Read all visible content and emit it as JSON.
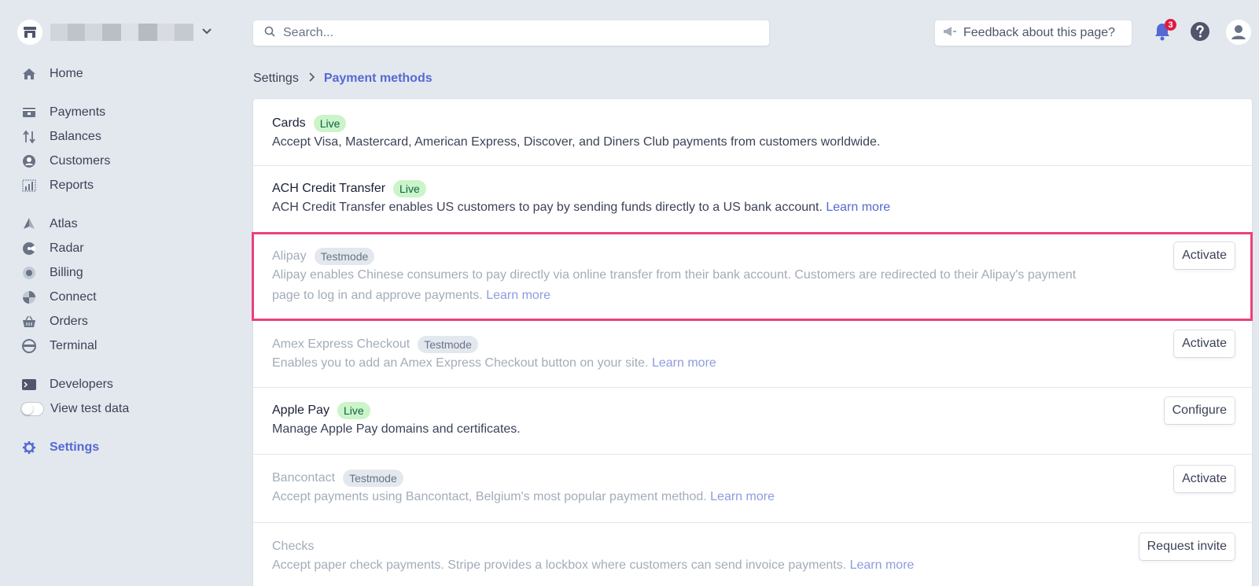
{
  "topbar": {
    "search_placeholder": "Search...",
    "feedback_label": "Feedback about this page?",
    "notification_count": "3"
  },
  "sidebar": {
    "items": [
      {
        "label": "Home",
        "icon": "home-icon"
      },
      {
        "label": "Payments",
        "icon": "payments-icon"
      },
      {
        "label": "Balances",
        "icon": "balances-icon"
      },
      {
        "label": "Customers",
        "icon": "customers-icon"
      },
      {
        "label": "Reports",
        "icon": "reports-icon"
      },
      {
        "label": "Atlas",
        "icon": "atlas-icon"
      },
      {
        "label": "Radar",
        "icon": "radar-icon"
      },
      {
        "label": "Billing",
        "icon": "billing-icon"
      },
      {
        "label": "Connect",
        "icon": "connect-icon"
      },
      {
        "label": "Orders",
        "icon": "orders-icon"
      },
      {
        "label": "Terminal",
        "icon": "terminal-icon"
      },
      {
        "label": "Developers",
        "icon": "developers-icon"
      },
      {
        "label": "View test data",
        "icon": "toggle"
      },
      {
        "label": "Settings",
        "icon": "gear-icon"
      }
    ]
  },
  "breadcrumb": {
    "root": "Settings",
    "current": "Payment methods"
  },
  "methods": [
    {
      "name": "Cards",
      "status": "Live",
      "desc": "Accept Visa, Mastercard, American Express, Discover, and Diners Club payments from customers worldwide."
    },
    {
      "name": "ACH Credit Transfer",
      "status": "Live",
      "desc": "ACH Credit Transfer enables US customers to pay by sending funds directly to a US bank account.",
      "link": "Learn more"
    },
    {
      "name": "Alipay",
      "status": "Testmode",
      "desc_line1": "Alipay enables Chinese consumers to pay directly via online transfer from their bank account. Customers are redirected to their Alipay's payment",
      "desc_line2": "page to log in and approve payments.",
      "link": "Learn more",
      "action": "Activate"
    },
    {
      "name": "Amex Express Checkout",
      "status": "Testmode",
      "desc": "Enables you to add an Amex Express Checkout button on your site.",
      "link": "Learn more",
      "action": "Activate"
    },
    {
      "name": "Apple Pay",
      "status": "Live",
      "desc": "Manage Apple Pay domains and certificates.",
      "action": "Configure"
    },
    {
      "name": "Bancontact",
      "status": "Testmode",
      "desc": "Accept payments using Bancontact, Belgium's most popular payment method.",
      "link": "Learn more",
      "action": "Activate"
    },
    {
      "name": "Checks",
      "desc": "Accept paper check payments. Stripe provides a lockbox where customers can send invoice payments.",
      "link": "Learn more",
      "action": "Request invite"
    }
  ],
  "colors": {
    "accent": "#5469d4",
    "live_bg": "#cbf4c9",
    "live_fg": "#0e6245",
    "highlight": "#ec407a",
    "background": "#e3e8ee"
  }
}
